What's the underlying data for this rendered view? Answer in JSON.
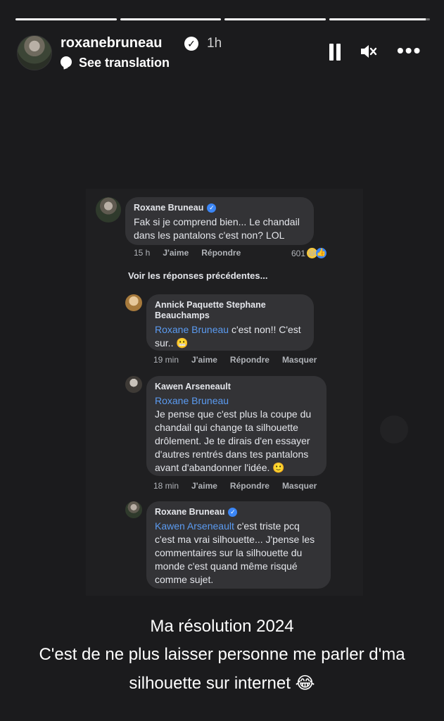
{
  "progress": [
    1,
    1,
    1,
    0.96
  ],
  "header": {
    "username": "roxanebruneau",
    "verified_glyph": "✓",
    "time": "1h",
    "translate_label": "See translation",
    "icons": [
      "pause-icon",
      "mute-icon",
      "more-icon"
    ]
  },
  "comments": {
    "c1": {
      "name": "Roxane Bruneau",
      "text": "Fak si je comprend bien... Le chandail dans les pantalons c'est non? LOL",
      "time": "15 h",
      "like": "J'aime",
      "reply": "Répondre",
      "reaction_count": "601"
    },
    "see_previous": "Voir les réponses précédentes...",
    "c2": {
      "name": "Annick Paquette Stephane Beauchamps",
      "mention": "Roxane Bruneau",
      "text": " c'est non!! C'est sur.. ",
      "emoji": "😬",
      "time": "19 min",
      "like": "J'aime",
      "reply": "Répondre",
      "hide": "Masquer"
    },
    "c3": {
      "name": "Kawen Arseneault",
      "mention": "Roxane Bruneau",
      "text": "Je pense que c'est plus la coupe du chandail qui change ta silhouette drôlement. Je te dirais d'en essayer d'autres rentrés dans tes pantalons avant d'abandonner l'idée. ",
      "emoji": "🙂",
      "time": "18 min",
      "like": "J'aime",
      "reply": "Répondre",
      "hide": "Masquer"
    },
    "c4": {
      "name": "Roxane Bruneau",
      "mention": "Kawen Arseneault",
      "text": " c'est triste pcq c'est ma vrai silhouette... J'pense les commentaires sur la silhouette du monde c'est quand même risqué comme sujet."
    }
  },
  "caption": {
    "line1": "Ma résolution 2024",
    "line2": "C'est de ne plus laisser personne me parler d'ma",
    "line3": "silhouette sur internet ",
    "emoji": "😂"
  }
}
